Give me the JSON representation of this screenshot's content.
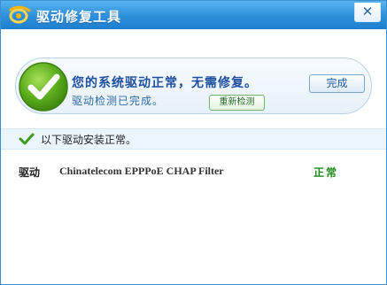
{
  "window": {
    "title": "驱动修复工具",
    "close_icon": "✕"
  },
  "status": {
    "main": "您的系统驱动正常，无需修复。",
    "sub": "驱动检测已完成。",
    "done_label": "完成",
    "recheck_label": "重新检测"
  },
  "summary": {
    "text": "以下驱动安装正常。"
  },
  "drivers": [
    {
      "category": "驱动",
      "name": "Chinatelecom EPPPoE CHAP Filter",
      "status": "正常"
    }
  ],
  "colors": {
    "titlebar": "#2d8fdb",
    "check_green": "#5cae1d",
    "status_text": "#1f4fa0",
    "ok_green": "#1b8a1b"
  },
  "icons": {
    "app": "app-logo-icon",
    "status": "checkmark-circle-icon",
    "summary": "checkmark-icon",
    "close": "close-icon"
  }
}
